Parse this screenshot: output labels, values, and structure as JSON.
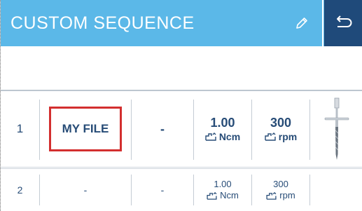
{
  "header": {
    "title": "CUSTOM SEQUENCE",
    "edit_icon": "pencil-icon",
    "back_icon": "undo-arrow-icon"
  },
  "colors": {
    "header_bg": "#5bb8e8",
    "undo_bg": "#1f4a7a",
    "text": "#274c77",
    "highlight": "#d32f2f"
  },
  "rows": [
    {
      "number": "1",
      "name": "MY FILE",
      "dash": "-",
      "torque_value": "1.00",
      "torque_unit": "Ncm",
      "speed_value": "300",
      "speed_unit": "rpm",
      "tool_icon": "drill-bit-icon"
    },
    {
      "number": "2",
      "name": "-",
      "dash": "-",
      "torque_value": "1.00",
      "torque_unit": "Ncm",
      "speed_value": "300",
      "speed_unit": "rpm"
    }
  ]
}
